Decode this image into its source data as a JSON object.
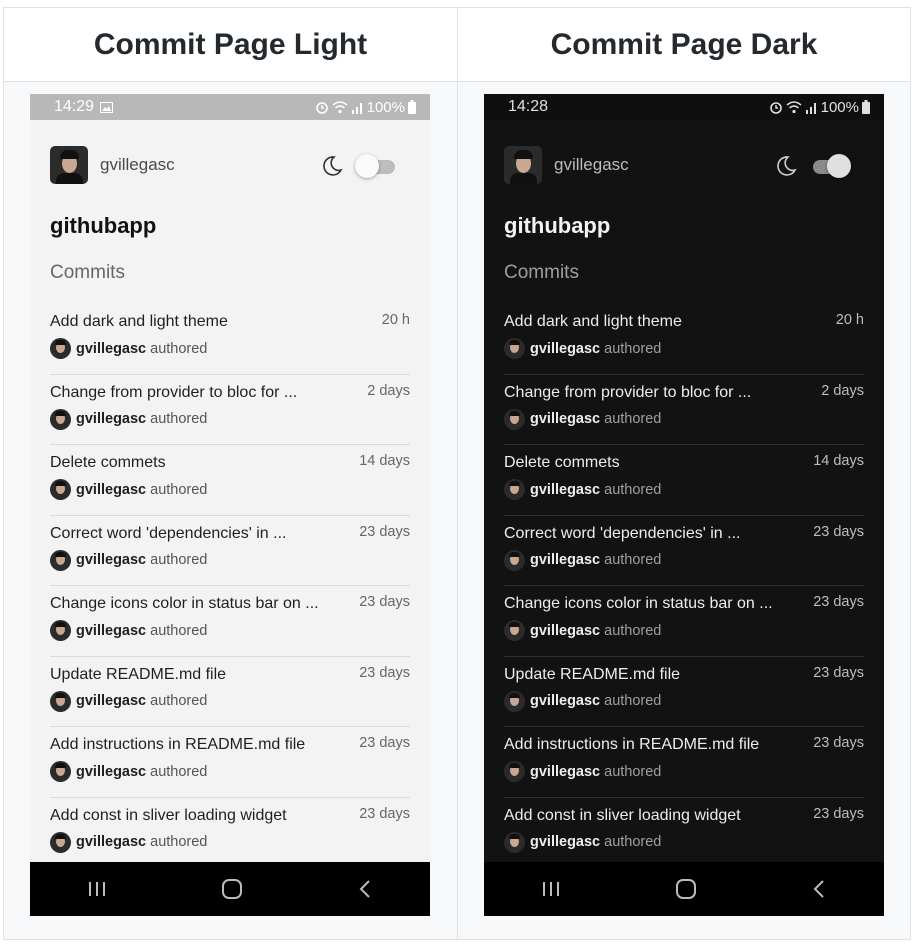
{
  "headers": {
    "light": "Commit Page Light",
    "dark": "Commit Page Dark"
  },
  "light": {
    "status_time": "14:29",
    "status_battery": "100%",
    "status_icons": [
      "image-icon",
      "alarm-icon",
      "wifi-icon",
      "signal-icon",
      "battery-icon"
    ],
    "username": "gvillegasc",
    "app_title": "githubapp",
    "section_title": "Commits",
    "theme_toggle_on": false
  },
  "dark": {
    "status_time": "14:28",
    "status_battery": "100%",
    "status_icons": [
      "alarm-icon",
      "wifi-icon",
      "signal-icon",
      "battery-icon"
    ],
    "username": "gvillegasc",
    "app_title": "githubapp",
    "section_title": "Commits",
    "theme_toggle_on": true
  },
  "commits": [
    {
      "message": "Add dark and light theme",
      "time": "20 h",
      "author": "gvillegasc",
      "suffix": "authored"
    },
    {
      "message": "Change from provider to bloc for ...",
      "time": "2 days",
      "author": "gvillegasc",
      "suffix": "authored"
    },
    {
      "message": "Delete commets",
      "time": "14 days",
      "author": "gvillegasc",
      "suffix": "authored"
    },
    {
      "message": "Correct word 'dependencies' in ...",
      "time": "23 days",
      "author": "gvillegasc",
      "suffix": "authored"
    },
    {
      "message": "Change icons color in status bar on ...",
      "time": "23 days",
      "author": "gvillegasc",
      "suffix": "authored"
    },
    {
      "message": "Update README.md file",
      "time": "23 days",
      "author": "gvillegasc",
      "suffix": "authored"
    },
    {
      "message": "Add instructions in README.md file",
      "time": "23 days",
      "author": "gvillegasc",
      "suffix": "authored"
    },
    {
      "message": "Add const in sliver loading widget",
      "time": "23 days",
      "author": "gvillegasc",
      "suffix": "authored"
    }
  ],
  "nav_icons": [
    "recent-apps-icon",
    "home-icon",
    "back-icon"
  ]
}
